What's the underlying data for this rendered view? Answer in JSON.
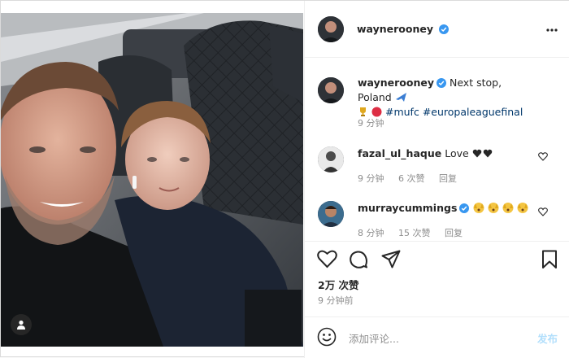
{
  "header": {
    "username": "waynerooney"
  },
  "caption": {
    "username": "waynerooney",
    "text": "Next stop, Poland",
    "emoji_line_tags": [
      "#mufc",
      "#europaleaguefinal"
    ],
    "time": "9 分钟"
  },
  "comments": [
    {
      "username": "fazal_ul_haque",
      "text": "Love",
      "time": "9 分钟",
      "likes": "6 次赞",
      "reply": "回复"
    },
    {
      "username": "murraycummings",
      "text": "",
      "time": "8 分钟",
      "likes": "15 次赞",
      "reply": "回复"
    }
  ],
  "actions": {
    "likes_count": "2万 次赞",
    "timestamp": "9 分钟前"
  },
  "comment_box": {
    "placeholder": "添加评论...",
    "post_label": "发布"
  },
  "colors": {
    "link": "#00376b",
    "verified": "#3897f0",
    "muted": "#8e8e8e",
    "post_disabled": "#b2dffc"
  },
  "icons": [
    "verified-badge-icon",
    "more-options-icon",
    "airplane-icon",
    "trophy-icon",
    "red-circle-icon",
    "black-heart-icon",
    "hands-face-icon",
    "heart-icon",
    "comment-icon",
    "share-icon",
    "bookmark-icon",
    "emoji-icon",
    "user-tag-icon"
  ]
}
